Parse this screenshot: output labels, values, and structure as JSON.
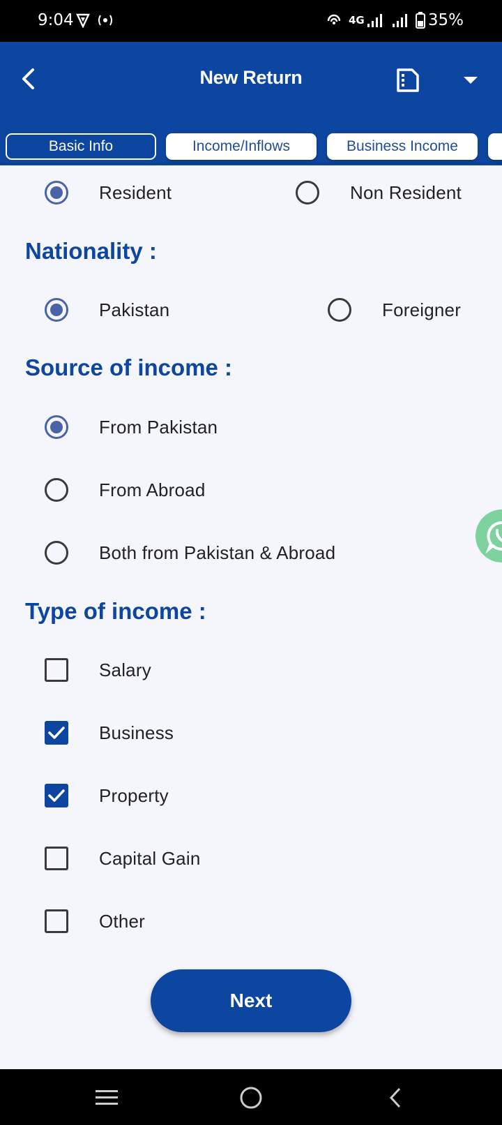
{
  "status_bar": {
    "time": "9:04",
    "network": "4G",
    "battery": "35%"
  },
  "app_bar": {
    "title": "New Return"
  },
  "tabs": [
    {
      "label": "Basic Info",
      "active": true
    },
    {
      "label": "Income/Inflows",
      "active": false
    },
    {
      "label": "Business Income",
      "active": false
    }
  ],
  "residency": {
    "options": [
      {
        "label": "Resident",
        "checked": true
      },
      {
        "label": "Non Resident",
        "checked": false
      }
    ]
  },
  "nationality": {
    "title": "Nationality :",
    "options": [
      {
        "label": "Pakistan",
        "checked": true
      },
      {
        "label": "Foreigner",
        "checked": false
      }
    ]
  },
  "source_of_income": {
    "title": "Source of income :",
    "options": [
      {
        "label": "From Pakistan",
        "checked": true
      },
      {
        "label": "From Abroad",
        "checked": false
      },
      {
        "label": "Both from Pakistan & Abroad",
        "checked": false
      }
    ]
  },
  "type_of_income": {
    "title": "Type of income :",
    "options": [
      {
        "label": "Salary",
        "checked": false
      },
      {
        "label": "Business",
        "checked": true
      },
      {
        "label": "Property",
        "checked": true
      },
      {
        "label": "Capital Gain",
        "checked": false
      },
      {
        "label": "Other",
        "checked": false
      }
    ]
  },
  "next_button": {
    "label": "Next"
  },
  "colors": {
    "primary": "#0d46a0",
    "radio_checked": "#4a63a6",
    "whatsapp": "#7ed29d"
  }
}
